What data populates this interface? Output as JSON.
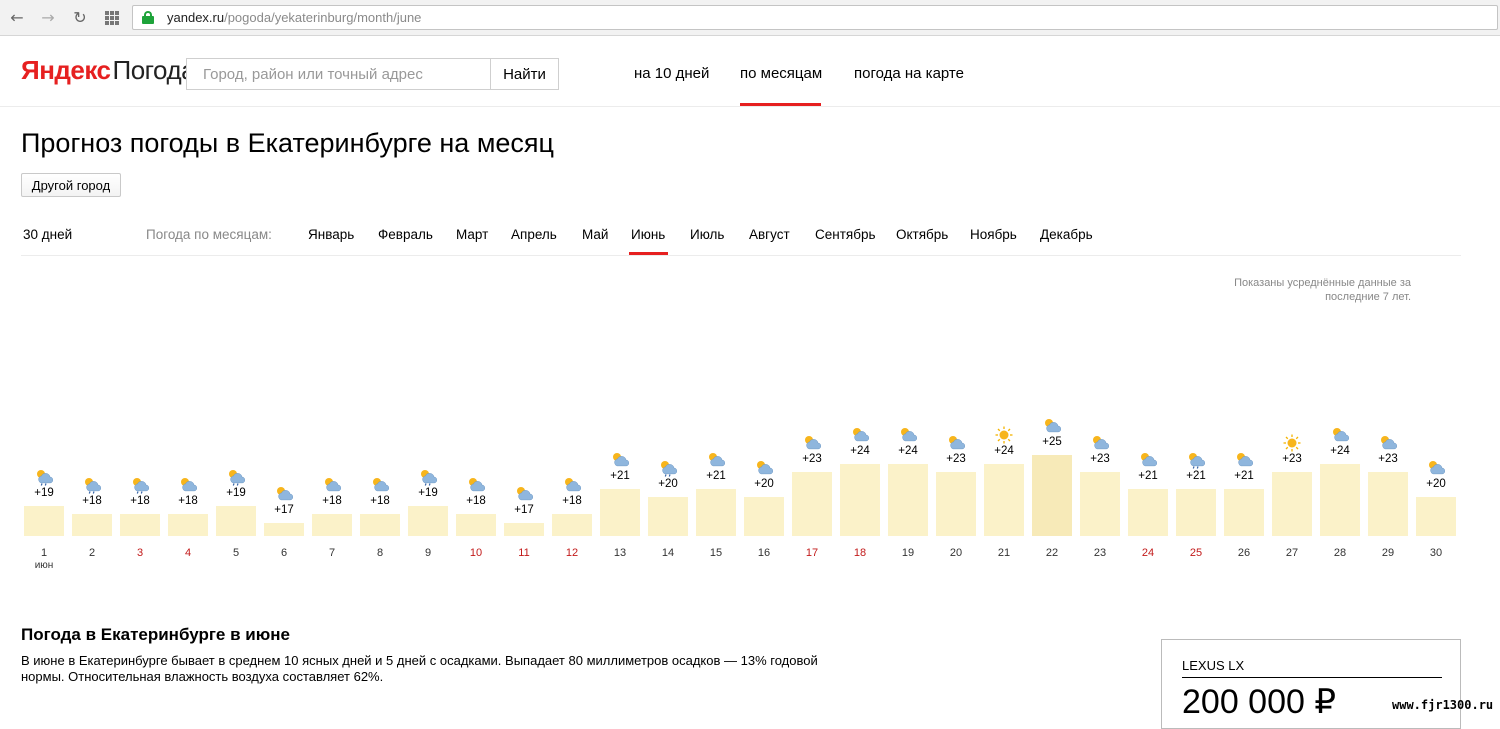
{
  "browser": {
    "url_host": "yandex.ru",
    "url_path": "/pogoda/yekaterinburg/month/june"
  },
  "header": {
    "logo_yandex": "Яндекс",
    "logo_service": "Погода",
    "search_placeholder": "Город, район или точный адрес",
    "search_button": "Найти",
    "nav": [
      "на 10 дней",
      "по месяцам",
      "погода на карте"
    ],
    "nav_active": "по месяцам"
  },
  "page_title": "Прогноз погоды в Екатеринбурге на месяц",
  "other_city_button": "Другой город",
  "month_nav": {
    "days30": "30 дней",
    "label": "Погода по месяцам:",
    "months": [
      "Январь",
      "Февраль",
      "Март",
      "Апрель",
      "Май",
      "Июнь",
      "Июль",
      "Август",
      "Сентябрь",
      "Октябрь",
      "Ноябрь",
      "Декабрь"
    ],
    "active": "Июнь"
  },
  "chart_note": "Показаны усреднённые данные за последние 7 лет.",
  "chart_data": {
    "type": "bar",
    "month_label": "июн",
    "categories": [
      "1",
      "2",
      "3",
      "4",
      "5",
      "6",
      "7",
      "8",
      "9",
      "10",
      "11",
      "12",
      "13",
      "14",
      "15",
      "16",
      "17",
      "18",
      "19",
      "20",
      "21",
      "22",
      "23",
      "24",
      "25",
      "26",
      "27",
      "28",
      "29",
      "30"
    ],
    "values": [
      19,
      18,
      18,
      18,
      19,
      17,
      18,
      18,
      19,
      18,
      17,
      18,
      21,
      20,
      21,
      20,
      23,
      24,
      24,
      23,
      24,
      25,
      23,
      21,
      21,
      21,
      23,
      24,
      23,
      20
    ],
    "labels": [
      "+19",
      "+18",
      "+18",
      "+18",
      "+19",
      "+17",
      "+18",
      "+18",
      "+19",
      "+18",
      "+17",
      "+18",
      "+21",
      "+20",
      "+21",
      "+20",
      "+23",
      "+24",
      "+24",
      "+23",
      "+24",
      "+25",
      "+23",
      "+21",
      "+21",
      "+21",
      "+23",
      "+24",
      "+23",
      "+20"
    ],
    "icons": [
      "cloudy-rain-icon",
      "cloudy-rain-icon",
      "cloudy-rain-icon",
      "partly-cloudy-icon",
      "cloudy-rain-icon",
      "partly-cloudy-icon",
      "partly-cloudy-icon",
      "partly-cloudy-icon",
      "cloudy-rain-icon",
      "partly-cloudy-icon",
      "partly-cloudy-icon",
      "partly-cloudy-icon",
      "partly-cloudy-icon",
      "cloudy-rain-icon",
      "partly-cloudy-icon",
      "partly-cloudy-icon",
      "partly-cloudy-icon",
      "partly-cloudy-icon",
      "partly-cloudy-icon",
      "partly-cloudy-icon",
      "sun-icon",
      "partly-cloudy-icon",
      "partly-cloudy-icon",
      "partly-cloudy-icon",
      "cloudy-rain-icon",
      "partly-cloudy-icon",
      "sun-icon",
      "partly-cloudy-icon",
      "partly-cloudy-icon",
      "partly-cloudy-icon"
    ],
    "weekends": [
      3,
      4,
      10,
      11,
      12,
      17,
      18,
      24,
      25
    ],
    "colors": {
      "bar": "#fbf2c9",
      "bar_hot": "#f7eab8",
      "weekend": "#c21a1a",
      "accent": "#e62020"
    }
  },
  "section": {
    "title": "Погода в Екатеринбурге в июне",
    "text": "В июне в Екатеринбурге бывает в среднем 10 ясных дней и 5 дней с осадками. Выпадает 80 миллиметров осадков — 13% годовой нормы. Относительная влажность воздуха составляет 62%."
  },
  "ad": {
    "title": "LEXUS LX",
    "price": "200 000 ₽"
  },
  "watermark": "www.fjr1300.ru"
}
